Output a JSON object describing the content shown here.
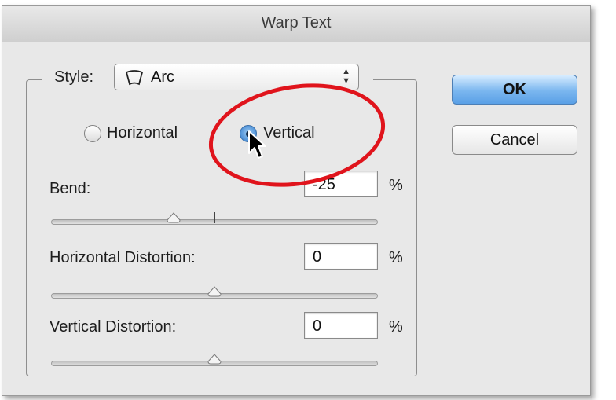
{
  "dialog": {
    "title": "Warp Text"
  },
  "style": {
    "label": "Style:",
    "value": "Arc",
    "icon": "arc-warp-icon"
  },
  "orientation": {
    "horizontal_label": "Horizontal",
    "vertical_label": "Vertical",
    "selected": "Vertical"
  },
  "bend": {
    "label": "Bend:",
    "value": "-25",
    "unit": "%",
    "slider_percent": -25
  },
  "horizontal_distortion": {
    "label": "Horizontal Distortion:",
    "value": "0",
    "unit": "%",
    "slider_percent": 0
  },
  "vertical_distortion": {
    "label": "Vertical Distortion:",
    "value": "0",
    "unit": "%",
    "slider_percent": 0
  },
  "buttons": {
    "ok_label": "OK",
    "cancel_label": "Cancel"
  },
  "colors": {
    "accent": "#5aa0e6",
    "annotation": "#e0141c"
  }
}
